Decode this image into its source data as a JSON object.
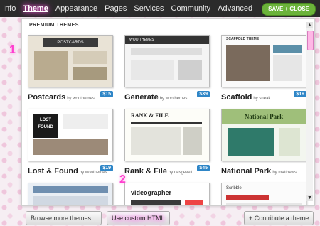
{
  "topbar": {
    "nav": [
      "Info",
      "Theme",
      "Appearance",
      "Pages",
      "Services",
      "Community",
      "Advanced"
    ],
    "active": "Theme",
    "save_label": "SAVE + CLOSE"
  },
  "panel": {
    "section_title": "PREMIUM THEMES",
    "themes": [
      {
        "name": "Postcards",
        "author": "by woothemes",
        "price": "$15",
        "thumb_title": "POSTCARDS"
      },
      {
        "name": "Generate",
        "author": "by woothemes",
        "price": "$39",
        "thumb_title": "WOO THEMES"
      },
      {
        "name": "Scaffold",
        "author": "by sneak",
        "price": "$19",
        "thumb_title": "SCAFFOLD THEME"
      },
      {
        "name": "Lost & Found",
        "author": "by woothemes",
        "price": "$19",
        "thumb_title": "LOST FOUND"
      },
      {
        "name": "Rank & File",
        "author": "by desgeveit",
        "price": "$45",
        "thumb_title": "RANK & FILE"
      },
      {
        "name": "National Park",
        "author": "by matthews",
        "price": "",
        "thumb_title": "National Park"
      },
      {
        "name": "",
        "author": "",
        "price": "",
        "thumb_title": ""
      },
      {
        "name": "",
        "author": "",
        "price": "",
        "thumb_title": "videographer"
      },
      {
        "name": "",
        "author": "",
        "price": "",
        "thumb_title": "Scribble"
      }
    ]
  },
  "bottom": {
    "browse_label": "Browse more themes...",
    "custom_label": "Use custom HTML",
    "contribute_label": "+ Contribute a theme"
  },
  "annotations": {
    "one": "1",
    "two": "2"
  },
  "colors": {
    "accent": "#6bb33a",
    "price_badge": "#2f86c7",
    "highlight": "#ff55dd"
  }
}
